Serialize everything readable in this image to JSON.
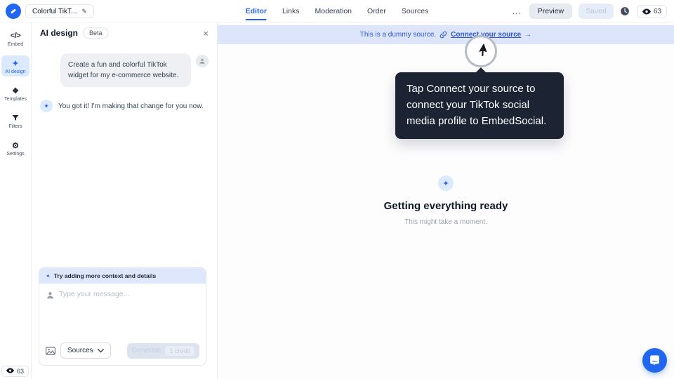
{
  "topbar": {
    "widget_name": "Colorful TikT...",
    "tabs": [
      {
        "label": "Editor"
      },
      {
        "label": "Links"
      },
      {
        "label": "Moderation"
      },
      {
        "label": "Order"
      },
      {
        "label": "Sources"
      }
    ],
    "more_label": "...",
    "preview_label": "Preview",
    "saved_label": "Saved",
    "views_count": "63"
  },
  "sidebar": {
    "items": [
      {
        "label": "Embed"
      },
      {
        "label": "AI design"
      },
      {
        "label": "Templates"
      },
      {
        "label": "Filters"
      },
      {
        "label": "Settings"
      }
    ],
    "views_count": "63"
  },
  "icons": {
    "embed_glyph": "</>",
    "sparkle_glyph": "✦",
    "templates_glyph": "❖",
    "gear_glyph": "⚙",
    "edit_glyph": "✎",
    "close_glyph": "×"
  },
  "panel": {
    "title": "AI design",
    "badge": "Beta",
    "user_message": "Create a fun and colorful TikTok widget for my e-commerce website.",
    "assistant_message": "You got it! I'm making that change for you now.",
    "composer": {
      "suggestion": "Try adding more context and details",
      "placeholder": "Type your message...",
      "sources_label": "Sources",
      "generate_label": "Generate",
      "credit_label": "1 credit"
    }
  },
  "main": {
    "banner": {
      "text": "This is a dummy source.",
      "link_label": "Connect your source",
      "arrow": "→"
    },
    "tooltip_text": "Tap Connect your source to connect your TikTok social media profile to EmbedSocial.",
    "loading": {
      "title": "Getting everything ready",
      "subtitle": "This might take a moment."
    }
  },
  "colors": {
    "accent": "#2563eb",
    "banner_bg": "#dce5fa",
    "banner_text": "#2e56d6",
    "tooltip_bg": "#1c2433",
    "active_nav_bg": "#dbeafe"
  }
}
